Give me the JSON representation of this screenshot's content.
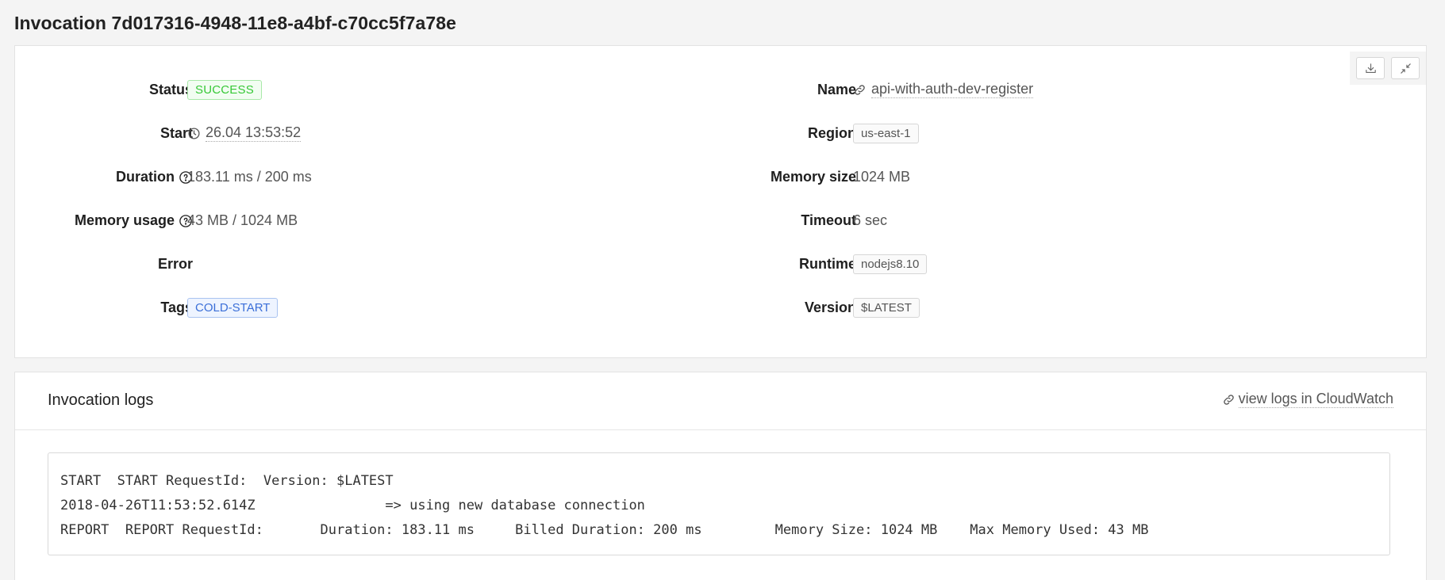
{
  "page": {
    "title": "Invocation 7d017316-4948-11e8-a4bf-c70cc5f7a78e"
  },
  "details": {
    "left": [
      {
        "key": "status",
        "label": "Status",
        "value": "SUCCESS"
      },
      {
        "key": "start",
        "label": "Start",
        "value": "26.04 13:53:52"
      },
      {
        "key": "duration",
        "label": "Duration",
        "value": "183.11 ms / 200 ms"
      },
      {
        "key": "memory_usage",
        "label": "Memory usage",
        "value": "43 MB / 1024 MB"
      },
      {
        "key": "error",
        "label": "Error",
        "value": ""
      },
      {
        "key": "tags",
        "label": "Tags",
        "value": "COLD-START"
      }
    ],
    "right": [
      {
        "key": "name",
        "label": "Name",
        "value": "api-with-auth-dev-register"
      },
      {
        "key": "region",
        "label": "Region",
        "value": "us-east-1"
      },
      {
        "key": "memory_size",
        "label": "Memory size",
        "value": "1024 MB"
      },
      {
        "key": "timeout",
        "label": "Timeout",
        "value": "6 sec"
      },
      {
        "key": "runtime",
        "label": "Runtime",
        "value": "nodejs8.10"
      },
      {
        "key": "version",
        "label": "Version",
        "value": "$LATEST"
      }
    ]
  },
  "actions": {
    "download_icon": "download-icon",
    "collapse_icon": "collapse-icon"
  },
  "logs": {
    "title": "Invocation logs",
    "cloudwatch_link": "view logs in CloudWatch",
    "lines": [
      "START  START RequestId:  Version: $LATEST",
      "2018-04-26T11:53:52.614Z                => using new database connection",
      "REPORT  REPORT RequestId:       Duration: 183.11 ms     Billed Duration: 200 ms         Memory Size: 1024 MB    Max Memory Used: 43 MB"
    ]
  },
  "colors": {
    "success": "#37c837",
    "tag": "#3b6fd8"
  }
}
